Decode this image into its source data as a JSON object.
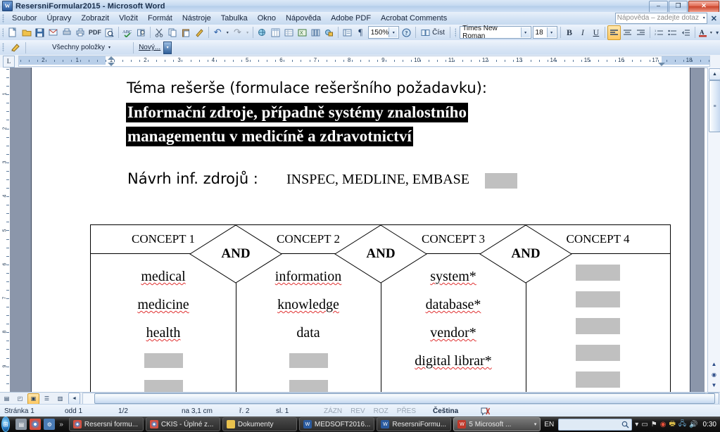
{
  "window": {
    "title": "ResersniFormular2015 - Microsoft Word",
    "app_icon": "word-icon",
    "minimize": "–",
    "restore": "❐",
    "close": "✕"
  },
  "menu": {
    "items": [
      {
        "label": "Soubor"
      },
      {
        "label": "Úpravy"
      },
      {
        "label": "Zobrazit"
      },
      {
        "label": "Vložit"
      },
      {
        "label": "Formát"
      },
      {
        "label": "Nástroje"
      },
      {
        "label": "Tabulka"
      },
      {
        "label": "Okno"
      },
      {
        "label": "Nápověda"
      },
      {
        "label": "Adobe PDF"
      },
      {
        "label": "Acrobat Comments"
      }
    ],
    "help_box": {
      "placeholder": "Nápověda – zadejte dotaz",
      "close": "✕"
    }
  },
  "toolbar_standard": {
    "buttons": [
      {
        "name": "new-document-icon",
        "glyph": "🗋"
      },
      {
        "name": "open-folder-icon",
        "glyph": "📂"
      },
      {
        "name": "save-icon",
        "glyph": "💾"
      },
      {
        "name": "email-icon",
        "glyph": "📧"
      },
      {
        "name": "print-preview-pdf-icon",
        "glyph": "🖨"
      },
      {
        "name": "print-icon",
        "glyph": "🖶"
      },
      {
        "name": "convert-to-pdf-label",
        "glyph": "PDF"
      },
      {
        "name": "print-preview-icon",
        "glyph": "🔍"
      },
      {
        "name": "spelling-check-icon",
        "glyph": "ABC"
      },
      {
        "name": "research-icon",
        "glyph": "📖"
      },
      {
        "name": "cut-icon",
        "glyph": "✂"
      },
      {
        "name": "copy-icon",
        "glyph": "⧉"
      },
      {
        "name": "paste-icon",
        "glyph": "📋"
      },
      {
        "name": "format-painter-icon",
        "glyph": "🖌"
      },
      {
        "name": "undo-icon",
        "glyph": "↶"
      },
      {
        "name": "undo-dropdown-icon",
        "glyph": "▾"
      },
      {
        "name": "redo-icon",
        "glyph": "↷"
      },
      {
        "name": "redo-dropdown-icon",
        "glyph": "▾"
      },
      {
        "name": "insert-hyperlink-icon",
        "glyph": "🌐"
      },
      {
        "name": "insert-table-excel-icon",
        "glyph": "▦"
      },
      {
        "name": "insert-table-icon",
        "glyph": "⊞"
      },
      {
        "name": "insert-excel-sheet-icon",
        "glyph": "▤"
      },
      {
        "name": "columns-icon",
        "glyph": "≣"
      },
      {
        "name": "drawing-icon",
        "glyph": "✎"
      },
      {
        "name": "document-map-icon",
        "glyph": "🗺"
      },
      {
        "name": "show-formatting-marks-icon",
        "glyph": "¶"
      }
    ],
    "zoom": {
      "value": "150%",
      "arrow": "▾"
    },
    "help_icon": "?",
    "read_button": {
      "icon": "📖",
      "label": "Číst"
    },
    "overflow": "▾"
  },
  "toolbar_formatting": {
    "font": {
      "value": "Times New Roman",
      "arrow": "▾"
    },
    "size": {
      "value": "18",
      "arrow": "▾"
    },
    "bold": {
      "label": "B",
      "active": false
    },
    "italic": {
      "label": "I",
      "active": false
    },
    "underline": {
      "label": "U",
      "active": false
    },
    "align_left": {
      "icon": "align-left-icon",
      "active": true
    },
    "align_center": {
      "icon": "align-center-icon",
      "active": false
    },
    "align_right": {
      "icon": "align-right-icon",
      "active": false
    },
    "numbered_list": {
      "icon": "numbered-list-icon"
    },
    "bulleted_list": {
      "icon": "bulleted-list-icon"
    },
    "decrease_indent": {
      "icon": "decrease-indent-icon"
    },
    "font_color": {
      "label": "A",
      "arrow": "▾",
      "color": "#c0392b"
    },
    "overflow": "▾"
  },
  "toolbar_third": {
    "icon": "adobe-acrobat-icon",
    "all_items": {
      "label": "Všechny položky",
      "arrow": "▾"
    },
    "new_button": {
      "label": "Nový..."
    },
    "overflow": "▾"
  },
  "ruler": {
    "tab_stop_button": "L",
    "numbers": [
      "2",
      "1",
      "1",
      "2",
      "3",
      "4",
      "5",
      "6",
      "7",
      "8",
      "9",
      "10",
      "11",
      "12",
      "13",
      "14",
      "15",
      "17",
      "18"
    ]
  },
  "vruler": {
    "numbers": [
      "1",
      "2",
      "3",
      "4",
      "5",
      "6",
      "7",
      "8",
      "9"
    ]
  },
  "document": {
    "line1": "Téma rešerše (formulace rešeršního požadavku):",
    "highlighted_line1": "Informační zdroje, případně systémy znalostního",
    "highlighted_line2": "managementu v medicíně a zdravotnictví",
    "line2_label": "Návrh inf. zdrojů :",
    "line2_value": "INSPEC, MEDLINE, EMBASE",
    "line2_formfield": "",
    "table": {
      "operator": "AND",
      "columns": [
        {
          "header": "CONCEPT 1",
          "terms": [
            "medical",
            "medicine",
            "health"
          ],
          "misspelled": [
            true,
            true,
            true
          ],
          "empty_fields": 2
        },
        {
          "header": "CONCEPT 2",
          "terms": [
            "information",
            "knowledge",
            "data"
          ],
          "misspelled": [
            true,
            true,
            false
          ],
          "empty_fields": 2
        },
        {
          "header": "CONCEPT 3",
          "terms": [
            "system*",
            "database*",
            "vendor*",
            "digital librar*"
          ],
          "misspelled": [
            true,
            true,
            true,
            true
          ],
          "empty_fields": 1
        },
        {
          "header": "CONCEPT 4",
          "terms": [],
          "misspelled": [],
          "empty_fields": 6
        }
      ]
    }
  },
  "scrollbars": {
    "up_arrow": "▲",
    "down_arrow": "▼",
    "left_arrow": "◄",
    "right_arrow": "►",
    "thumb_label": "≡",
    "prev_page": "▲",
    "select_object": "◉",
    "next_page": "▼"
  },
  "view_buttons": [
    {
      "name": "normal-view-icon",
      "glyph": "▤",
      "active": false
    },
    {
      "name": "web-layout-view-icon",
      "glyph": "◰",
      "active": false
    },
    {
      "name": "print-layout-view-icon",
      "glyph": "▣",
      "active": true
    },
    {
      "name": "outline-view-icon",
      "glyph": "☰",
      "active": false
    },
    {
      "name": "reading-layout-view-icon",
      "glyph": "▥",
      "active": false
    }
  ],
  "status_bar": {
    "page": "Stránka 1",
    "section": "odd 1",
    "page_count": "1/2",
    "position": "na 3,1 cm",
    "line": "ř. 2",
    "column": "sl. 1",
    "rec": "ZÁZN",
    "trk": "REV",
    "ext": "ROZ",
    "ovr": "PŘES",
    "language": "Čeština",
    "spell_icon": "spell-check-status-icon"
  },
  "taskbar": {
    "start": "start-orb-icon",
    "quicklaunch": [
      {
        "name": "show-desktop-icon",
        "glyph": "▤",
        "color": "#9aa5b1"
      },
      {
        "name": "chrome-icon",
        "glyph": "◉",
        "color": "#d94f3d"
      },
      {
        "name": "network-app-icon",
        "glyph": "⚙",
        "color": "#4a90d9"
      }
    ],
    "chevron": "»",
    "tasks": [
      {
        "label": "Resersni formu...",
        "icon": "chrome-icon",
        "color": "#d94f3d",
        "active": false
      },
      {
        "label": "CKIS - Úplné z...",
        "icon": "chrome-icon",
        "color": "#d94f3d",
        "active": false
      },
      {
        "label": "Dokumenty",
        "icon": "folder-icon",
        "color": "#e8c14d",
        "active": false
      },
      {
        "label": "MEDSOFT2016...",
        "icon": "word-icon",
        "color": "#2a5a9e",
        "active": false
      },
      {
        "label": "ResersniFormu...",
        "icon": "word-icon",
        "color": "#2a5a9e",
        "active": false
      },
      {
        "label": "5 Microsoft ...",
        "icon": "word-group-icon",
        "color": "#c0392b",
        "active": true,
        "arrow": "▾"
      }
    ],
    "language": "EN",
    "search_icon": "search-icon",
    "tray": [
      {
        "name": "tray-show-hidden-icon",
        "glyph": "▾"
      },
      {
        "name": "tray-monitor-icon",
        "glyph": "▭"
      },
      {
        "name": "tray-action-center-icon",
        "glyph": "⚑"
      },
      {
        "name": "tray-antivirus-icon",
        "glyph": "◉"
      },
      {
        "name": "tray-printer-icon",
        "glyph": "🖶"
      },
      {
        "name": "tray-network-icon",
        "glyph": "🖧"
      },
      {
        "name": "tray-volume-icon",
        "glyph": "🔊"
      }
    ],
    "clock": "0:30"
  }
}
